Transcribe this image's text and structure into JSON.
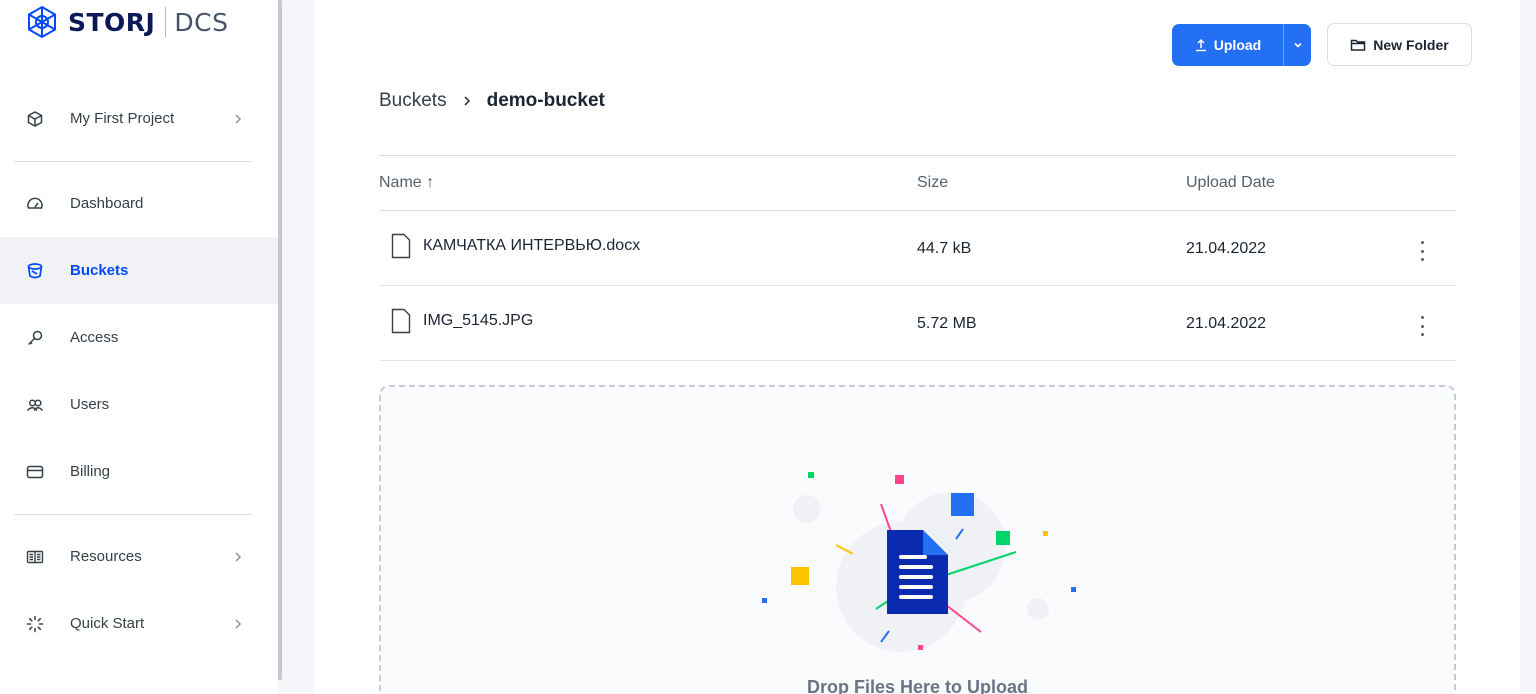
{
  "brand": {
    "name": "STORJ",
    "product": "DCS"
  },
  "sidebar": {
    "project": {
      "label": "My First Project",
      "icon": "cube-icon"
    },
    "items": [
      {
        "label": "Dashboard",
        "icon": "gauge-icon",
        "active": false
      },
      {
        "label": "Buckets",
        "icon": "bucket-icon",
        "active": true
      },
      {
        "label": "Access",
        "icon": "key-icon",
        "active": false
      },
      {
        "label": "Users",
        "icon": "users-icon",
        "active": false
      },
      {
        "label": "Billing",
        "icon": "card-icon",
        "active": false
      }
    ],
    "footer_items": [
      {
        "label": "Resources",
        "icon": "book-icon"
      },
      {
        "label": "Quick Start",
        "icon": "loader-icon"
      }
    ]
  },
  "toolbar": {
    "upload_label": "Upload",
    "new_folder_label": "New Folder"
  },
  "breadcrumb": {
    "root": "Buckets",
    "current": "demo-bucket"
  },
  "table": {
    "columns": [
      "Name ↑",
      "Size",
      "Upload Date"
    ],
    "rows": [
      {
        "name": "КАМЧАТКА ИНТЕРВЬЮ.docx",
        "size": "44.7 kB",
        "date": "21.04.2022"
      },
      {
        "name": "IMG_5145.JPG",
        "size": "5.72 MB",
        "date": "21.04.2022"
      }
    ]
  },
  "dropzone": {
    "label": "Drop Files Here to Upload"
  },
  "colors": {
    "accent": "#2370f5",
    "active_text": "#0149ff",
    "brand_dark": "#0b1a56"
  }
}
